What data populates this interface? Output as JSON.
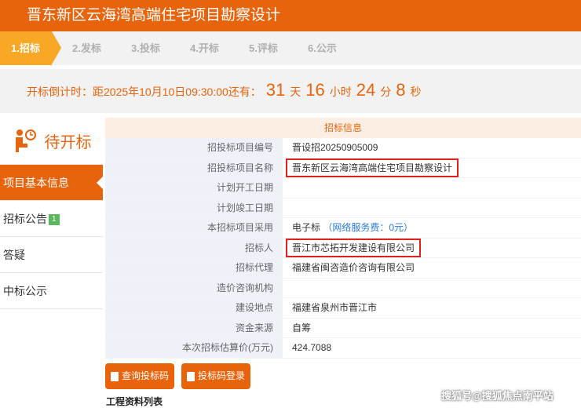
{
  "title": "晋东新区云海湾高端住宅项目勘察设计",
  "steps": [
    "1.招标",
    "2.发标",
    "3.投标",
    "4.开标",
    "5.评标",
    "6.公示"
  ],
  "countdown": {
    "prefix": "开标倒计时：距2025年10月10日09:30:00还有：",
    "days": "31",
    "days_unit": "天",
    "hours": "16",
    "hours_unit": "小时",
    "minutes": "24",
    "minutes_unit": "分",
    "seconds": "8",
    "seconds_unit": "秒"
  },
  "sidebar": {
    "status": "待开标",
    "items": [
      {
        "label": "项目基本信息"
      },
      {
        "label": "招标公告",
        "badge": "1"
      },
      {
        "label": "答疑"
      },
      {
        "label": "中标公示"
      }
    ]
  },
  "info": {
    "header": "招标信息",
    "rows": [
      {
        "label": "招投标项目编号",
        "value": "晋设招20250905009"
      },
      {
        "label": "招投标项目名称",
        "value": "晋东新区云海湾高端住宅项目勘察设计"
      },
      {
        "label": "计划开工日期",
        "value": ""
      },
      {
        "label": "计划竣工日期",
        "value": ""
      },
      {
        "label": "本招标项目采用",
        "value": "电子标",
        "extra": "（网络服务费：0元）"
      },
      {
        "label": "招标人",
        "value": "晋江市芯拓开发建设有限公司"
      },
      {
        "label": "招标代理",
        "value": "福建省闽咨造价咨询有限公司"
      },
      {
        "label": "造价咨询机构",
        "value": ""
      },
      {
        "label": "建设地点",
        "value": "福建省泉州市晋江市"
      },
      {
        "label": "资金来源",
        "value": "自筹"
      },
      {
        "label": "本次招标估算价(万元)",
        "value": "424.7088"
      }
    ]
  },
  "buttons": {
    "query": "查询投标码",
    "login": "投标码登录"
  },
  "section_title": "工程资料列表",
  "watermark": "搜狐号@搜狐焦点南平站"
}
